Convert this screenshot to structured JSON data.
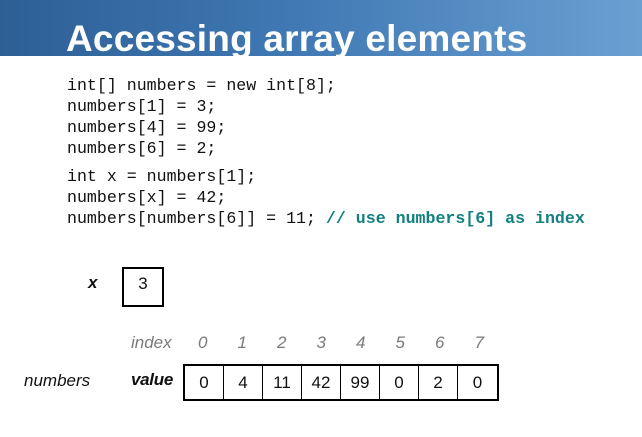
{
  "slide": {
    "title": "Accessing array elements",
    "code_block_1": [
      "int[] numbers = new int[8];",
      "numbers[1] = 3;",
      "numbers[4] = 99;",
      "numbers[6] = 2;"
    ],
    "code_block_2": [
      "int x = numbers[1];",
      "numbers[x] = 42;"
    ],
    "code_line_last": "numbers[numbers[6]] = 11; ",
    "code_comment": "// use numbers[6] as index"
  },
  "diagram": {
    "x_label": "x",
    "x_value": "3",
    "numbers_label": "numbers",
    "index_label": "index",
    "value_label": "value",
    "indices": [
      "0",
      "1",
      "2",
      "3",
      "4",
      "5",
      "6",
      "7"
    ],
    "values": [
      "0",
      "4",
      "11",
      "42",
      "99",
      "0",
      "2",
      "0"
    ]
  }
}
